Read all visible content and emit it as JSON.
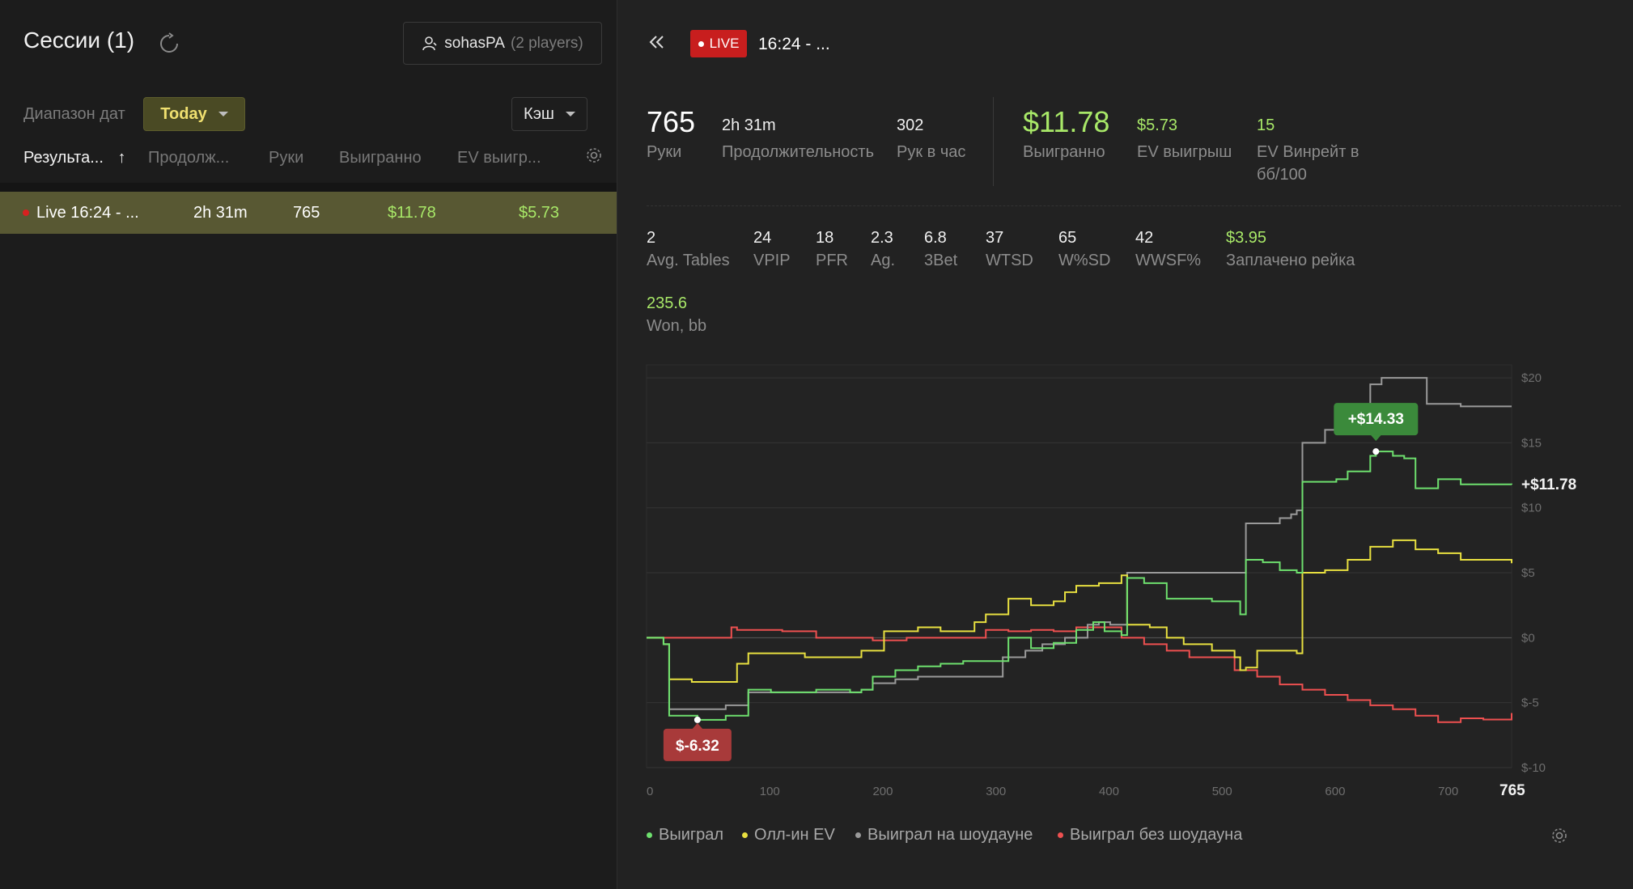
{
  "sidebar": {
    "title": "Сессии (1)",
    "player_name": "sohasPA",
    "player_count": "(2 players)",
    "date_range_label": "Диапазон дат",
    "date_range_value": "Today",
    "game_type": "Кэш",
    "columns": [
      "Результа...",
      "Продолж...",
      "Руки",
      "Выигранно",
      "EV выигр..."
    ],
    "sort_arrow": "↑",
    "sessions": [
      {
        "name": "Live 16:24 - ...",
        "duration": "2h 31m",
        "hands": "765",
        "won": "$11.78",
        "ev_won": "$5.73"
      }
    ]
  },
  "header": {
    "live_label": "LIVE",
    "session_title": "16:24 - ..."
  },
  "stats_main": [
    {
      "value": "765",
      "label": "Руки"
    },
    {
      "value": "2h 31m",
      "label": "Продолжительность"
    },
    {
      "value": "302",
      "label": "Рук в час"
    },
    {
      "value": "$11.78",
      "label": "Выигранно"
    },
    {
      "value": "$5.73",
      "label": "EV выигрыш"
    },
    {
      "value": "15",
      "label": "EV Винрейт в",
      "label2": "бб/100"
    }
  ],
  "stats_secondary": [
    {
      "value": "2",
      "label": "Avg. Tables"
    },
    {
      "value": "24",
      "label": "VPIP"
    },
    {
      "value": "18",
      "label": "PFR"
    },
    {
      "value": "2.3",
      "label": "Ag."
    },
    {
      "value": "6.8",
      "label": "3Bet"
    },
    {
      "value": "37",
      "label": "WTSD"
    },
    {
      "value": "65",
      "label": "W%SD"
    },
    {
      "value": "42",
      "label": "WWSF%"
    },
    {
      "value": "$3.95",
      "label": "Заплачено рейка"
    }
  ],
  "stats_third": [
    {
      "value": "235.6",
      "label": "Won, bb"
    }
  ],
  "colors": {
    "won": "#6ee06e",
    "allin_ev": "#e8e040",
    "showdown": "#9a9a9a",
    "non_showdown": "#ee5050",
    "accent_green": "#a8e868",
    "live_red": "#c81e1e"
  },
  "chart_data": {
    "type": "line",
    "xlim": [
      0,
      765
    ],
    "ylim": [
      -10,
      21
    ],
    "x_ticks": [
      "0",
      "100",
      "200",
      "300",
      "400",
      "500",
      "600",
      "700"
    ],
    "x_end_label": "765",
    "y_ticks": [
      "$20",
      "$15",
      "$10",
      "$5",
      "$0",
      "$-5",
      "$-10"
    ],
    "end_value_label": "+$11.78",
    "max_label": "+$14.33",
    "max_point": {
      "x": 645,
      "y": 14.33
    },
    "min_label": "$-6.32",
    "min_point": {
      "x": 45,
      "y": -6.32
    },
    "series": [
      {
        "name": "Выиграл",
        "color": "#6ee06e",
        "points": [
          [
            0,
            0
          ],
          [
            15,
            -0.5
          ],
          [
            20,
            -6
          ],
          [
            45,
            -6.32
          ],
          [
            70,
            -6
          ],
          [
            85,
            -6
          ],
          [
            90,
            -4
          ],
          [
            110,
            -4.2
          ],
          [
            150,
            -4
          ],
          [
            180,
            -4.2
          ],
          [
            190,
            -4
          ],
          [
            200,
            -3
          ],
          [
            220,
            -2.5
          ],
          [
            240,
            -2.2
          ],
          [
            260,
            -2
          ],
          [
            280,
            -1.8
          ],
          [
            300,
            -1.8
          ],
          [
            320,
            0
          ],
          [
            340,
            -0.8
          ],
          [
            360,
            -0.4
          ],
          [
            380,
            0.6
          ],
          [
            395,
            1.2
          ],
          [
            405,
            0.5
          ],
          [
            420,
            0.2
          ],
          [
            425,
            4.6
          ],
          [
            440,
            4.2
          ],
          [
            460,
            3
          ],
          [
            480,
            3
          ],
          [
            500,
            2.8
          ],
          [
            525,
            1.8
          ],
          [
            530,
            6
          ],
          [
            545,
            5.8
          ],
          [
            560,
            5.2
          ],
          [
            575,
            5
          ],
          [
            580,
            12
          ],
          [
            600,
            12
          ],
          [
            610,
            12.2
          ],
          [
            620,
            12.8
          ],
          [
            640,
            14
          ],
          [
            645,
            14.33
          ],
          [
            660,
            14
          ],
          [
            670,
            13.8
          ],
          [
            680,
            11.5
          ],
          [
            700,
            12.2
          ],
          [
            720,
            11.8
          ],
          [
            765,
            11.78
          ]
        ]
      },
      {
        "name": "Олл-ин EV",
        "color": "#e8e040",
        "points": [
          [
            0,
            0
          ],
          [
            15,
            -0.5
          ],
          [
            20,
            -3.2
          ],
          [
            40,
            -3.4
          ],
          [
            70,
            -3.4
          ],
          [
            80,
            -2
          ],
          [
            90,
            -1.2
          ],
          [
            110,
            -1.2
          ],
          [
            140,
            -1.5
          ],
          [
            190,
            -1
          ],
          [
            210,
            0.5
          ],
          [
            240,
            0.8
          ],
          [
            260,
            0.5
          ],
          [
            290,
            1.2
          ],
          [
            300,
            1.8
          ],
          [
            315,
            1.8
          ],
          [
            320,
            3
          ],
          [
            340,
            2.5
          ],
          [
            360,
            2.8
          ],
          [
            370,
            3.5
          ],
          [
            380,
            4
          ],
          [
            400,
            4.2
          ],
          [
            420,
            4.8
          ],
          [
            425,
            1
          ],
          [
            445,
            0.8
          ],
          [
            460,
            0
          ],
          [
            475,
            -0.5
          ],
          [
            500,
            -1
          ],
          [
            520,
            -1.5
          ],
          [
            525,
            -2.5
          ],
          [
            530,
            -2.3
          ],
          [
            540,
            -1
          ],
          [
            560,
            -1
          ],
          [
            575,
            -1.2
          ],
          [
            580,
            5
          ],
          [
            600,
            5.2
          ],
          [
            620,
            6
          ],
          [
            640,
            7
          ],
          [
            660,
            7.5
          ],
          [
            680,
            6.8
          ],
          [
            700,
            6.5
          ],
          [
            720,
            6
          ],
          [
            765,
            5.73
          ]
        ]
      },
      {
        "name": "Выиграл на шоудауне",
        "color": "#9a9a9a",
        "points": [
          [
            0,
            0
          ],
          [
            15,
            -0.5
          ],
          [
            20,
            -5.5
          ],
          [
            40,
            -5.5
          ],
          [
            60,
            -5.5
          ],
          [
            70,
            -5.2
          ],
          [
            90,
            -4.2
          ],
          [
            110,
            -4.2
          ],
          [
            190,
            -4
          ],
          [
            200,
            -3.5
          ],
          [
            220,
            -3.2
          ],
          [
            240,
            -3
          ],
          [
            260,
            -3
          ],
          [
            280,
            -3
          ],
          [
            300,
            -3
          ],
          [
            312,
            -3
          ],
          [
            315,
            -1.5
          ],
          [
            335,
            -1
          ],
          [
            350,
            -0.5
          ],
          [
            370,
            0
          ],
          [
            390,
            1
          ],
          [
            400,
            1.2
          ],
          [
            410,
            1
          ],
          [
            425,
            5
          ],
          [
            440,
            5
          ],
          [
            500,
            5
          ],
          [
            525,
            5
          ],
          [
            530,
            8.8
          ],
          [
            560,
            9.2
          ],
          [
            570,
            9.5
          ],
          [
            575,
            9.8
          ],
          [
            580,
            15
          ],
          [
            600,
            16
          ],
          [
            620,
            17.5
          ],
          [
            640,
            19.5
          ],
          [
            650,
            20
          ],
          [
            680,
            20
          ],
          [
            690,
            18
          ],
          [
            720,
            17.8
          ],
          [
            765,
            17.8
          ]
        ]
      },
      {
        "name": "Выиграл без шоудауна",
        "color": "#ee5050",
        "points": [
          [
            0,
            0
          ],
          [
            15,
            0
          ],
          [
            70,
            0
          ],
          [
            75,
            0.8
          ],
          [
            80,
            0.6
          ],
          [
            120,
            0.5
          ],
          [
            150,
            0
          ],
          [
            180,
            0
          ],
          [
            200,
            -0.2
          ],
          [
            230,
            0
          ],
          [
            260,
            0
          ],
          [
            300,
            0.6
          ],
          [
            320,
            0.5
          ],
          [
            340,
            0.6
          ],
          [
            360,
            0.5
          ],
          [
            380,
            0.8
          ],
          [
            400,
            0.8
          ],
          [
            420,
            0
          ],
          [
            440,
            -0.5
          ],
          [
            460,
            -1
          ],
          [
            480,
            -1.5
          ],
          [
            500,
            -1.5
          ],
          [
            520,
            -2.5
          ],
          [
            540,
            -3
          ],
          [
            560,
            -3.6
          ],
          [
            580,
            -4
          ],
          [
            600,
            -4.4
          ],
          [
            620,
            -4.8
          ],
          [
            640,
            -5.2
          ],
          [
            660,
            -5.5
          ],
          [
            680,
            -6
          ],
          [
            700,
            -6.5
          ],
          [
            720,
            -6.2
          ],
          [
            740,
            -6.3
          ],
          [
            765,
            -5.8
          ]
        ]
      }
    ],
    "legend": [
      "Выиграл",
      "Олл-ин EV",
      "Выиграл на шоудауне",
      "Выиграл без шоудауна"
    ],
    "legend_position": "bottom"
  }
}
